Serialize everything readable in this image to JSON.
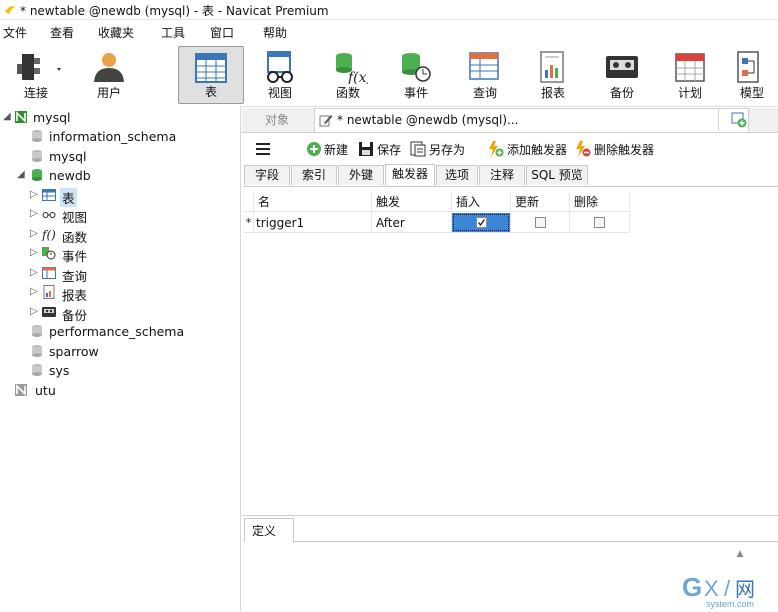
{
  "window": {
    "title": "* newtable @newdb (mysql) - 表 - Navicat Premium"
  },
  "menu": [
    "文件",
    "查看",
    "收藏夹",
    "工具",
    "窗口",
    "帮助"
  ],
  "toolbar": {
    "items": [
      {
        "label": "连接",
        "icon": "connection-icon"
      },
      {
        "label": "用户",
        "icon": "user-icon"
      },
      {
        "label": "表",
        "icon": "table-icon",
        "active": true
      },
      {
        "label": "视图",
        "icon": "view-icon"
      },
      {
        "label": "函数",
        "icon": "function-icon"
      },
      {
        "label": "事件",
        "icon": "event-icon"
      },
      {
        "label": "查询",
        "icon": "query-icon"
      },
      {
        "label": "报表",
        "icon": "report-icon"
      },
      {
        "label": "备份",
        "icon": "backup-icon"
      },
      {
        "label": "计划",
        "icon": "schedule-icon"
      },
      {
        "label": "模型",
        "icon": "model-icon"
      }
    ]
  },
  "sidebar": {
    "tree": [
      {
        "label": "mysql",
        "level": 0,
        "expanded": true
      },
      {
        "label": "information_schema",
        "level": 1
      },
      {
        "label": "mysql",
        "level": 1
      },
      {
        "label": "newdb",
        "level": 1,
        "expanded": true
      },
      {
        "label": "表",
        "level": 2,
        "selected": true
      },
      {
        "label": "视图",
        "level": 2
      },
      {
        "label": "函数",
        "level": 2
      },
      {
        "label": "事件",
        "level": 2
      },
      {
        "label": "查询",
        "level": 2
      },
      {
        "label": "报表",
        "level": 2
      },
      {
        "label": "备份",
        "level": 2
      },
      {
        "label": "performance_schema",
        "level": 1
      },
      {
        "label": "sparrow",
        "level": 1
      },
      {
        "label": "sys",
        "level": 1
      },
      {
        "label": "utu",
        "level": 0
      }
    ]
  },
  "tabs": {
    "objects": "对象",
    "doc": "* newtable @newdb (mysql)..."
  },
  "actions": {
    "new": "新建",
    "save": "保存",
    "save_as": "另存为",
    "add_trigger": "添加触发器",
    "delete_trigger": "删除触发器"
  },
  "subtabs": [
    "字段",
    "索引",
    "外键",
    "触发器",
    "选项",
    "注释",
    "SQL 预览"
  ],
  "active_subtab": 3,
  "grid": {
    "columns": [
      "名",
      "触发",
      "插入",
      "更新",
      "删除"
    ],
    "rows": [
      {
        "marker": "*",
        "name": "trigger1",
        "fire": "After",
        "insert": true,
        "update": false,
        "delete": false
      }
    ]
  },
  "definition": {
    "tab": "定义"
  },
  "colors": {
    "selection": "#3b86d6",
    "active_tool_bg": "#e0e0e0"
  }
}
